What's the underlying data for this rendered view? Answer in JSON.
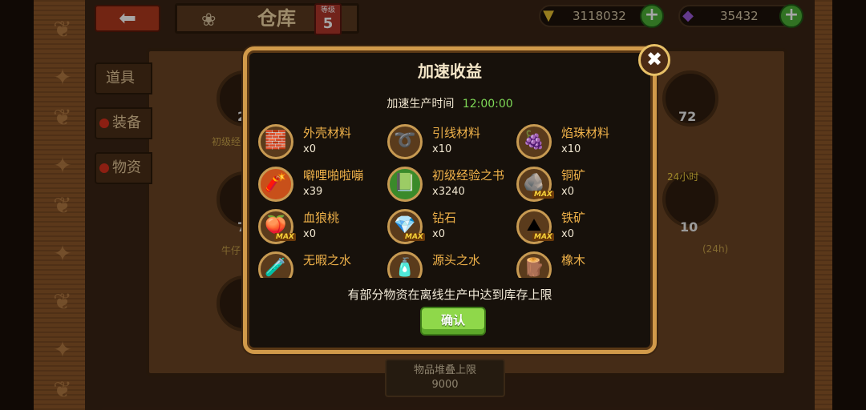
{
  "header": {
    "title": "仓库",
    "level_label": "等级",
    "level_value": "5",
    "gold": "3118032",
    "gems": "35432",
    "back_icon": "back-arrow-icon"
  },
  "tabs": [
    {
      "label": "道具"
    },
    {
      "label": "装备"
    },
    {
      "label": "物资"
    }
  ],
  "background": {
    "stack_limit_label": "物品堆叠上限",
    "stack_limit_value": "9000",
    "badge_24h": "24小时",
    "counts": [
      "2",
      "72",
      "7",
      "10"
    ],
    "captions": [
      "初级经",
      "牛仔",
      "(24h)"
    ]
  },
  "dialog": {
    "title": "加速收益",
    "speed_label": "加速生产时间",
    "speed_time": "12:00:00",
    "notice": "有部分物资在离线生产中达到库存上限",
    "confirm": "确认",
    "colors": {
      "border": "#d19a4a",
      "timer": "#7ed957",
      "item_name": "#f0b24a",
      "confirm": "#8fd84a"
    },
    "items": [
      {
        "name": "外壳材料",
        "qty": "x0",
        "icon": "shell-material-icon",
        "max": false
      },
      {
        "name": "引线材料",
        "qty": "x10",
        "icon": "fuse-material-icon",
        "max": false
      },
      {
        "name": "焰珠材料",
        "qty": "x10",
        "icon": "flame-bead-icon",
        "max": false
      },
      {
        "name": "噼哩啪啦嘣",
        "qty": "x39",
        "icon": "firecracker-icon",
        "max": false
      },
      {
        "name": "初级经验之书",
        "qty": "x3240",
        "icon": "exp-book-icon",
        "max": false
      },
      {
        "name": "铜矿",
        "qty": "x0",
        "icon": "copper-ore-icon",
        "max": true
      },
      {
        "name": "血狼桃",
        "qty": "x0",
        "icon": "wolf-peach-icon",
        "max": true
      },
      {
        "name": "钻石",
        "qty": "x0",
        "icon": "diamond-icon",
        "max": true
      },
      {
        "name": "铁矿",
        "qty": "x0",
        "icon": "iron-ore-icon",
        "max": true
      },
      {
        "name": "无暇之水",
        "qty": "",
        "icon": "flawless-water-icon",
        "max": false
      },
      {
        "name": "源头之水",
        "qty": "",
        "icon": "source-water-icon",
        "max": false
      },
      {
        "name": "橡木",
        "qty": "",
        "icon": "oak-wood-icon",
        "max": false
      }
    ],
    "max_label": "MAX"
  }
}
